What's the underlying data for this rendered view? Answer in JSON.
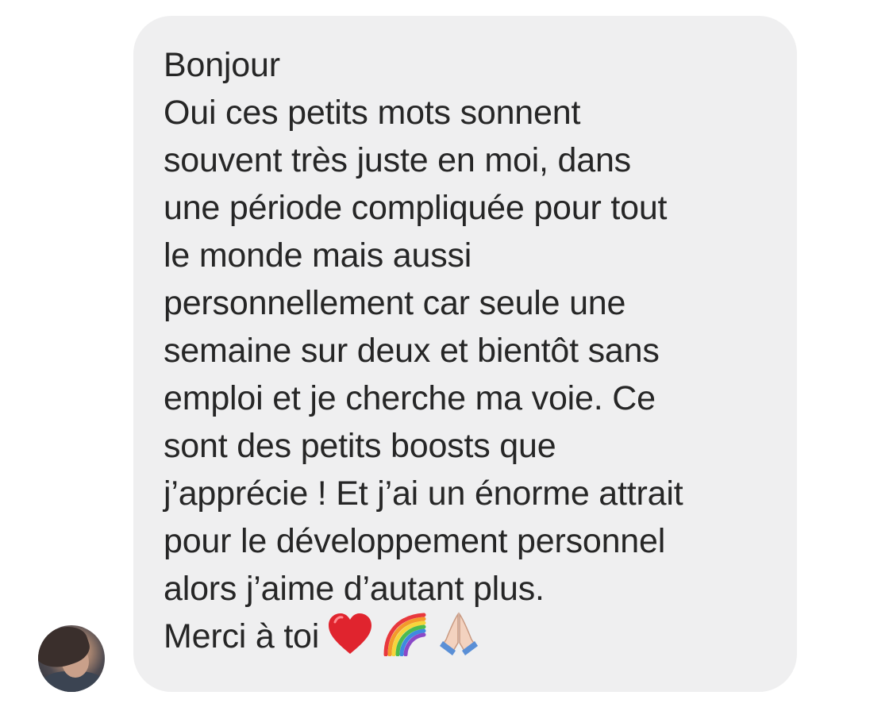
{
  "message": {
    "lines": [
      "Bonjour",
      "Oui ces petits mots sonnent",
      "souvent très juste en moi, dans",
      "une période compliquée pour tout",
      "le monde mais aussi",
      "personnellement car seule une",
      "semaine sur deux et bientôt sans",
      "emploi et je cherche ma voie. Ce",
      "sont des petits boosts que",
      "j’apprécie ! Et j’ai un énorme attrait",
      "pour le développement personnel",
      "alors j’aime d’autant plus.",
      "Merci à toi"
    ],
    "emojis": [
      "heart-emoji",
      "rainbow-emoji",
      "folded-hands-emoji"
    ]
  },
  "colors": {
    "bubble_background": "#efeff0",
    "text": "#262626",
    "page_background": "#ffffff"
  }
}
